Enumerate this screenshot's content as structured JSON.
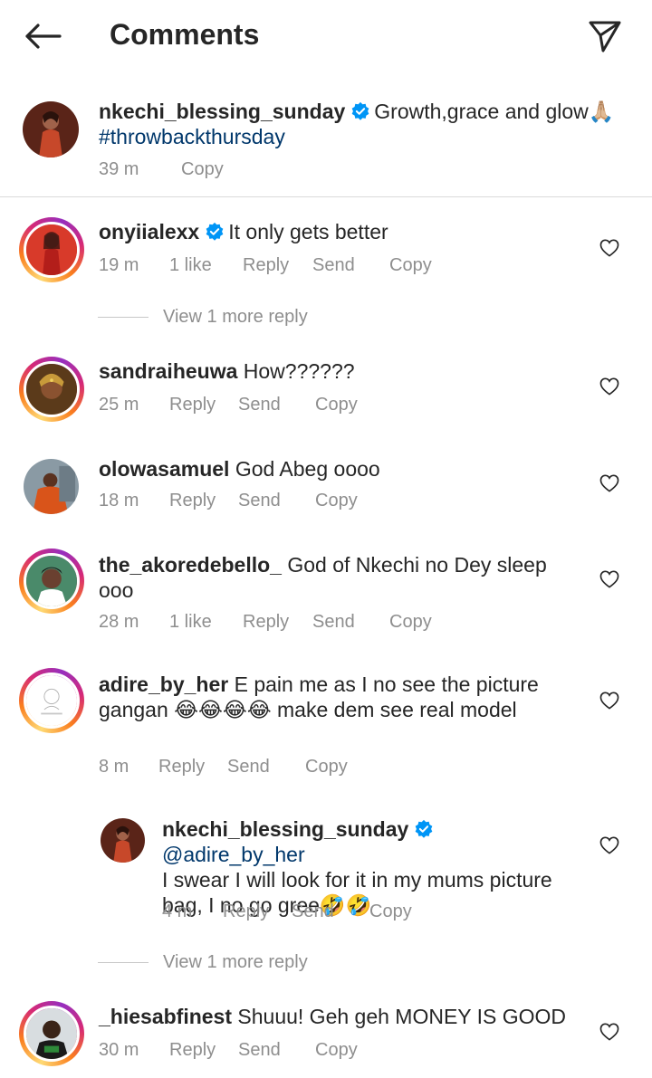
{
  "header": {
    "title": "Comments"
  },
  "caption": {
    "username": "nkechi_blessing_sunday",
    "text": "Growth,grace and glow🙏🏼",
    "hashtag": "#throwbackthursday",
    "time": "39 m",
    "copy": "Copy"
  },
  "comments": [
    {
      "username": "onyiialexx",
      "verified": true,
      "text": "It only gets better",
      "time": "19 m",
      "likes": "1 like",
      "reply": "Reply",
      "send": "Send",
      "copy": "Copy",
      "view_more": "View 1 more reply"
    },
    {
      "username": "sandraiheuwa",
      "text": "How??????",
      "time": "25 m",
      "reply": "Reply",
      "send": "Send",
      "copy": "Copy"
    },
    {
      "username": "olowasamuel",
      "text": "God Abeg oooo",
      "time": "18 m",
      "reply": "Reply",
      "send": "Send",
      "copy": "Copy"
    },
    {
      "username": "the_akoredebello_",
      "text": "God of Nkechi no Dey sleep ooo",
      "time": "28 m",
      "likes": "1 like",
      "reply": "Reply",
      "send": "Send",
      "copy": "Copy"
    },
    {
      "username": "adire_by_her",
      "text": "E pain me as I no see the picture gangan 😂😂😂😂 make dem see real model",
      "time": "8 m",
      "reply": "Reply",
      "send": "Send",
      "copy": "Copy",
      "reply_item": {
        "username": "nkechi_blessing_sunday",
        "verified": true,
        "mention": "@adire_by_her",
        "text": "I swear I will look for it in my mums picture bag, I no go gree🤣🤣",
        "time": "4 m",
        "reply": "Reply",
        "send": "Send",
        "copy": "Copy"
      },
      "view_more": "View 1 more reply"
    },
    {
      "username": "_hiesabfinest",
      "text": "Shuuu! Geh geh MONEY IS GOOD",
      "time": "30 m",
      "reply": "Reply",
      "send": "Send",
      "copy": "Copy"
    }
  ],
  "colors": {
    "text": "#262626",
    "secondary": "#8e8e8e",
    "link": "#00376b",
    "verified": "#0095f6",
    "divider": "#dbdbdb"
  }
}
